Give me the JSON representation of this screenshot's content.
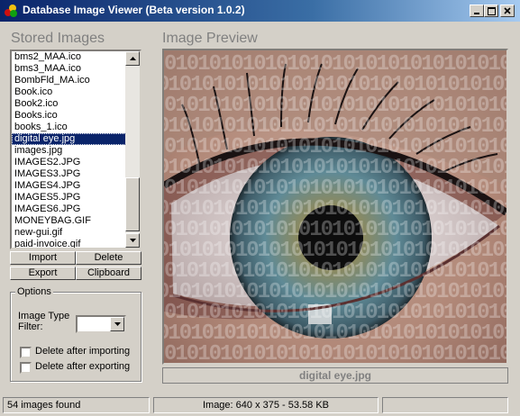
{
  "window": {
    "title": "Database Image Viewer (Beta version 1.0.2)",
    "icon": "app-icon",
    "controls": [
      "minimize-icon",
      "maximize-icon",
      "close-icon"
    ]
  },
  "stored_images": {
    "heading": "Stored Images",
    "items": [
      "bms2_MAA.ico",
      "bms3_MAA.ico",
      "BombFld_MA.ico",
      "Book.ico",
      "Book2.ico",
      "Books.ico",
      "books_1.ico",
      "digital eye.jpg",
      "images.jpg",
      "IMAGES2.JPG",
      "IMAGES3.JPG",
      "IMAGES4.JPG",
      "IMAGES5.JPG",
      "IMAGES6.JPG",
      "MONEYBAG.GIF",
      "new-gui.gif",
      "paid-invoice.gif"
    ],
    "selected": "digital eye.jpg"
  },
  "buttons": {
    "import": "Import",
    "delete": "Delete",
    "export": "Export",
    "clipboard": "Clipboard"
  },
  "options": {
    "legend": "Options",
    "filter_label_1": "Image Type",
    "filter_label_2": "Filter:",
    "filter_value": "",
    "delete_after_importing": "Delete after importing",
    "delete_after_exporting": "Delete after exporting",
    "delete_after_importing_checked": false,
    "delete_after_exporting_checked": false
  },
  "preview": {
    "heading": "Image Preview",
    "caption": "digital eye.jpg",
    "binary_pattern": "01010101010101010101010101010101010101010"
  },
  "status": {
    "count": "54 images found",
    "image_info": "Image: 640 x 375 - 53.58 KB",
    "extra": ""
  },
  "colors": {
    "title_bar": "#0a246a",
    "selection": "#0a246a",
    "face": "#d4d0c8"
  }
}
